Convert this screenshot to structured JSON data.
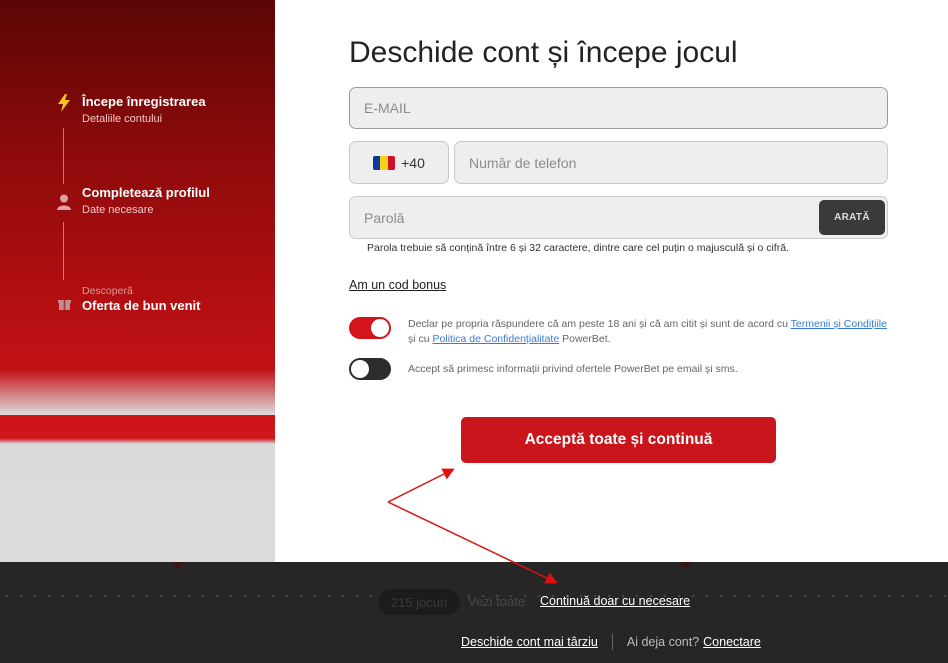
{
  "steps": [
    {
      "title": "Începe înregistrarea",
      "subtitle": "Detaliile contului",
      "icon": "lightning-icon"
    },
    {
      "title": "Completează profilul",
      "subtitle": "Date necesare",
      "icon": "user-icon"
    },
    {
      "title": "Oferta de bun venit",
      "subtitle": "Descoperă",
      "icon": "gift-icon"
    }
  ],
  "form": {
    "heading": "Deschide cont și începe jocul",
    "email_placeholder": "E-MAIL",
    "phone_prefix": "+40",
    "phone_placeholder": "Număr de telefon",
    "password_placeholder": "Parolă",
    "show_password": "ARATĂ",
    "password_hint": "Parola trebuie să conțină între 6 și 32 caractere, dintre care cel puțin o majusculă și o cifră.",
    "bonus_link": "Am un cod bonus",
    "consent_terms": {
      "text_1": "Declar pe propria răspundere că am peste 18 ani și că am citit și sunt de acord cu ",
      "link_terms": "Termenii și Condițiile",
      "text_2": " și cu ",
      "link_privacy": "Politica de Confidențialitate",
      "text_3": " PowerBet.",
      "checked": true
    },
    "consent_marketing": {
      "text": "Accept să primesc informații privind ofertele PowerBet pe email și sms.",
      "checked": false
    },
    "cta": "Acceptă toate și continuă"
  },
  "footer": {
    "continue_necessary": "Continuă doar cu necesare",
    "open_later": "Deschide cont mai târziu",
    "have_account": "Ai deja cont?",
    "login": "Conectare",
    "bg_games_count": "215 jocuri",
    "bg_see_all": "Vezi toate"
  },
  "colors": {
    "accent": "#d4141b",
    "flag_blue": "#0b3a9c",
    "flag_yellow": "#f7d117",
    "flag_red": "#ce1126",
    "annotation_arrow": "#e01010"
  }
}
